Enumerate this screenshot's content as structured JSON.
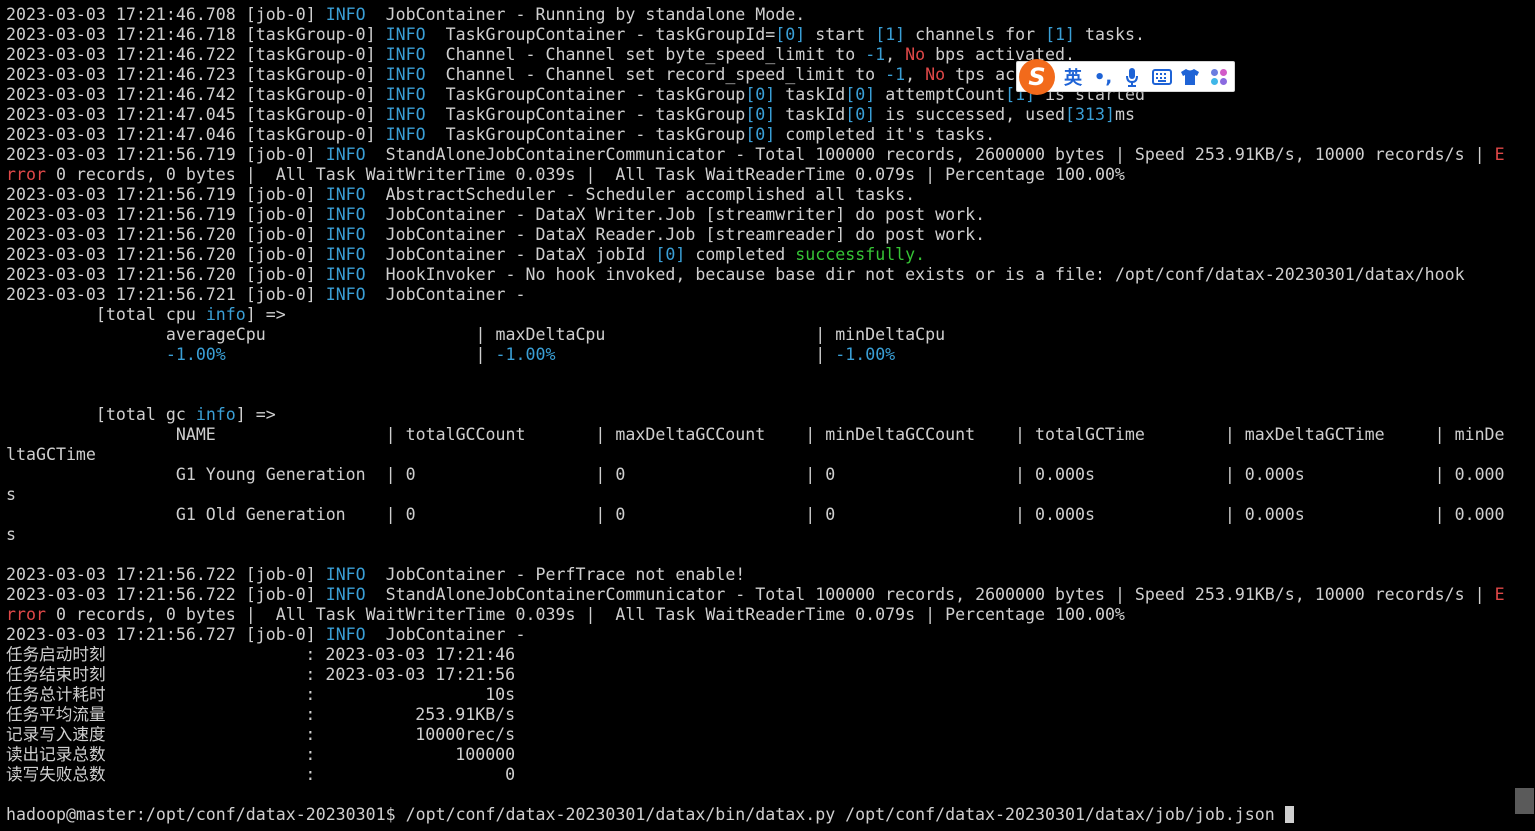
{
  "terminal": {
    "lines": [
      [
        [
          "2023-03-03 17:21:46.708 [job-0] ",
          "d"
        ],
        [
          "INFO",
          "b"
        ],
        [
          "  JobContainer - Running by standalone Mode.",
          "d"
        ]
      ],
      [
        [
          "2023-03-03 17:21:46.718 [taskGroup-0] ",
          "d"
        ],
        [
          "INFO",
          "b"
        ],
        [
          "  TaskGroupContainer - taskGroupId=",
          "d"
        ],
        [
          "[0]",
          "b"
        ],
        [
          " start ",
          "d"
        ],
        [
          "[1]",
          "b"
        ],
        [
          " channels for ",
          "d"
        ],
        [
          "[1]",
          "b"
        ],
        [
          " tasks.",
          "d"
        ]
      ],
      [
        [
          "2023-03-03 17:21:46.722 [taskGroup-0] ",
          "d"
        ],
        [
          "INFO",
          "b"
        ],
        [
          "  Channel - Channel set byte_speed_limit to ",
          "d"
        ],
        [
          "-1",
          "b"
        ],
        [
          ", ",
          "d"
        ],
        [
          "No",
          "r"
        ],
        [
          " bps activated.",
          "d"
        ]
      ],
      [
        [
          "2023-03-03 17:21:46.723 [taskGroup-0] ",
          "d"
        ],
        [
          "INFO",
          "b"
        ],
        [
          "  Channel - Channel set record_speed_limit to ",
          "d"
        ],
        [
          "-1",
          "b"
        ],
        [
          ", ",
          "d"
        ],
        [
          "No",
          "r"
        ],
        [
          " tps activated.",
          "d"
        ]
      ],
      [
        [
          "2023-03-03 17:21:46.742 [taskGroup-0] ",
          "d"
        ],
        [
          "INFO",
          "b"
        ],
        [
          "  TaskGroupContainer - taskGroup",
          "d"
        ],
        [
          "[0]",
          "b"
        ],
        [
          " taskId",
          "d"
        ],
        [
          "[0]",
          "b"
        ],
        [
          " attemptCount",
          "d"
        ],
        [
          "[1]",
          "b"
        ],
        [
          " is started",
          "d"
        ]
      ],
      [
        [
          "2023-03-03 17:21:47.045 [taskGroup-0] ",
          "d"
        ],
        [
          "INFO",
          "b"
        ],
        [
          "  TaskGroupContainer - taskGroup",
          "d"
        ],
        [
          "[0]",
          "b"
        ],
        [
          " taskId",
          "d"
        ],
        [
          "[0]",
          "b"
        ],
        [
          " is successed, used",
          "d"
        ],
        [
          "[313]",
          "b"
        ],
        [
          "ms",
          "d"
        ]
      ],
      [
        [
          "2023-03-03 17:21:47.046 [taskGroup-0] ",
          "d"
        ],
        [
          "INFO",
          "b"
        ],
        [
          "  TaskGroupContainer - taskGroup",
          "d"
        ],
        [
          "[0]",
          "b"
        ],
        [
          " completed it's tasks.",
          "d"
        ]
      ],
      [
        [
          "2023-03-03 17:21:56.719 [job-0] ",
          "d"
        ],
        [
          "INFO",
          "b"
        ],
        [
          "  StandAloneJobContainerCommunicator - Total 100000 records, 2600000 bytes | Speed 253.91KB/s, 10000 records/s | ",
          "d"
        ],
        [
          "E",
          "r"
        ]
      ],
      [
        [
          "rror",
          "r"
        ],
        [
          " 0 records, 0 bytes |  All Task WaitWriterTime 0.039s |  All Task WaitReaderTime 0.079s | Percentage 100.00%",
          "d"
        ]
      ],
      [
        [
          "2023-03-03 17:21:56.719 [job-0] ",
          "d"
        ],
        [
          "INFO",
          "b"
        ],
        [
          "  AbstractScheduler - Scheduler accomplished all tasks.",
          "d"
        ]
      ],
      [
        [
          "2023-03-03 17:21:56.719 [job-0] ",
          "d"
        ],
        [
          "INFO",
          "b"
        ],
        [
          "  JobContainer - DataX Writer.Job [streamwriter] do post work.",
          "d"
        ]
      ],
      [
        [
          "2023-03-03 17:21:56.720 [job-0] ",
          "d"
        ],
        [
          "INFO",
          "b"
        ],
        [
          "  JobContainer - DataX Reader.Job [streamreader] do post work.",
          "d"
        ]
      ],
      [
        [
          "2023-03-03 17:21:56.720 [job-0] ",
          "d"
        ],
        [
          "INFO",
          "b"
        ],
        [
          "  JobContainer - DataX jobId ",
          "d"
        ],
        [
          "[0]",
          "b"
        ],
        [
          " completed ",
          "d"
        ],
        [
          "successfully.",
          "g"
        ]
      ],
      [
        [
          "2023-03-03 17:21:56.720 [job-0] ",
          "d"
        ],
        [
          "INFO",
          "b"
        ],
        [
          "  HookInvoker - No hook invoked, because base dir not exists or is a file: /opt/conf/datax-20230301/datax/hook",
          "d"
        ]
      ],
      [
        [
          "2023-03-03 17:21:56.721 [job-0] ",
          "d"
        ],
        [
          "INFO",
          "b"
        ],
        [
          "  JobContainer - ",
          "d"
        ]
      ],
      [
        [
          "         [total cpu ",
          "d"
        ],
        [
          "info",
          "b"
        ],
        [
          "] =>",
          "d"
        ]
      ],
      [
        [
          "                averageCpu                     | maxDeltaCpu                     | minDeltaCpu",
          "d"
        ]
      ],
      [
        [
          "                -1.00%",
          "b"
        ],
        [
          "                         | ",
          "d"
        ],
        [
          "-1.00%",
          "b"
        ],
        [
          "                          | ",
          "d"
        ],
        [
          "-1.00%",
          "b"
        ]
      ],
      [
        [
          "",
          "d"
        ]
      ],
      [
        [
          "",
          "d"
        ]
      ],
      [
        [
          "         [total gc ",
          "d"
        ],
        [
          "info",
          "b"
        ],
        [
          "] =>",
          "d"
        ]
      ],
      [
        [
          "                 NAME                 | totalGCCount       | maxDeltaGCCount    | minDeltaGCCount    | totalGCTime        | maxDeltaGCTime     | minDe",
          "d"
        ]
      ],
      [
        [
          "ltaGCTime",
          "d"
        ]
      ],
      [
        [
          "                 G1 Young Generation  | 0                  | 0                  | 0                  | 0.000s             | 0.000s             | 0.000",
          "d"
        ]
      ],
      [
        [
          "s",
          "d"
        ]
      ],
      [
        [
          "                 G1 Old Generation    | 0                  | 0                  | 0                  | 0.000s             | 0.000s             | 0.000",
          "d"
        ]
      ],
      [
        [
          "s",
          "d"
        ]
      ],
      [
        [
          "",
          "d"
        ]
      ],
      [
        [
          "2023-03-03 17:21:56.722 [job-0] ",
          "d"
        ],
        [
          "INFO",
          "b"
        ],
        [
          "  JobContainer - PerfTrace not enable!",
          "d"
        ]
      ],
      [
        [
          "2023-03-03 17:21:56.722 [job-0] ",
          "d"
        ],
        [
          "INFO",
          "b"
        ],
        [
          "  StandAloneJobContainerCommunicator - Total 100000 records, 2600000 bytes | Speed 253.91KB/s, 10000 records/s | ",
          "d"
        ],
        [
          "E",
          "r"
        ]
      ],
      [
        [
          "rror",
          "r"
        ],
        [
          " 0 records, 0 bytes |  All Task WaitWriterTime 0.039s |  All Task WaitReaderTime 0.079s | Percentage 100.00%",
          "d"
        ]
      ],
      [
        [
          "2023-03-03 17:21:56.727 [job-0] ",
          "d"
        ],
        [
          "INFO",
          "b"
        ],
        [
          "  JobContainer - ",
          "d"
        ]
      ],
      [
        [
          "任务启动时刻                    : 2023-03-03 17:21:46",
          "d"
        ]
      ],
      [
        [
          "任务结束时刻                    : 2023-03-03 17:21:56",
          "d"
        ]
      ],
      [
        [
          "任务总计耗时                    :                 10s",
          "d"
        ]
      ],
      [
        [
          "任务平均流量                    :          253.91KB/s",
          "d"
        ]
      ],
      [
        [
          "记录写入速度                    :          10000rec/s",
          "d"
        ]
      ],
      [
        [
          "读出记录总数                    :              100000",
          "d"
        ]
      ],
      [
        [
          "读写失败总数                    :                   0",
          "d"
        ]
      ],
      [
        [
          "",
          "d"
        ]
      ],
      [
        [
          "hadoop@master:/opt/conf/datax-20230301$ /opt/conf/datax-20230301/datax/bin/datax.py /opt/conf/datax-20230301/datax/job/job.json ",
          "d"
        ]
      ]
    ]
  },
  "colors": {
    "background": "#000000",
    "text": "#cfcfcf",
    "info_blue": "#3a9fd6",
    "error_red": "#e04848",
    "success_green": "#35c435",
    "ime_orange": "#f26a1b",
    "ime_blue": "#1e63d6"
  },
  "ime_toolbar": {
    "logo": "S",
    "language": "英",
    "punctuation": "•,",
    "icons": [
      "microphone-icon",
      "keyboard-icon",
      "tshirt-skin-icon",
      "apps-grid-icon"
    ]
  }
}
